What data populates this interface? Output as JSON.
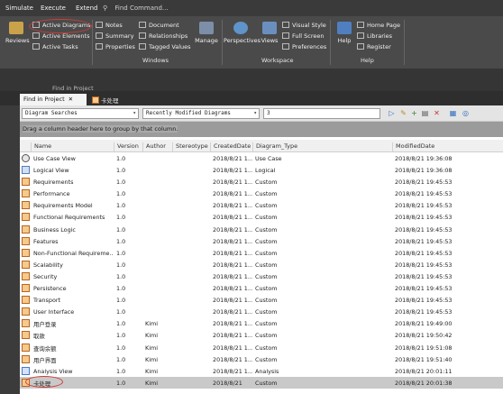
{
  "menu": {
    "items": [
      "Simulate",
      "Execute",
      "Extend"
    ],
    "find_command": "Find Command..."
  },
  "ribbon": {
    "reviews_label": "Reviews",
    "col1": [
      "Active Diagrams",
      "Active Elements",
      "Active Tasks"
    ],
    "col2": [
      "Notes",
      "Summary",
      "Properties"
    ],
    "col3": [
      "Document",
      "Relationships",
      "Tagged Values"
    ],
    "manage_label": "Manage",
    "windows_group": "Windows",
    "perspectives_label": "Perspectives",
    "views_label": "Views",
    "col4": [
      "Visual Style",
      "Full Screen",
      "Preferences"
    ],
    "workspace_group": "Workspace",
    "help_label": "Help",
    "col5": [
      "Home Page",
      "Libraries",
      "Register"
    ],
    "help_group": "Help"
  },
  "strip": {
    "in_project": "Find in Project"
  },
  "tabs": {
    "active": "Find in Project",
    "close": "✕",
    "other": "卡处理"
  },
  "toolbar": {
    "search_type": "Diagram Searches",
    "search_name": "Recently Modified Diagrams",
    "search_value": "3"
  },
  "groupby": {
    "hint": "Drag a column header here to group by that column."
  },
  "grid": {
    "columns": [
      "Name",
      "Version",
      "Author",
      "Stereotype",
      "CreatedDate",
      "Diagram_Type",
      "ModifiedDate"
    ],
    "rows": [
      {
        "icon": "usecase",
        "name": "Use Case View",
        "version": "1.0",
        "author": "",
        "stereo": "",
        "created": "2018/8/21 1...",
        "type": "Use Case",
        "modified": "2018/8/21 19:36:08"
      },
      {
        "icon": "logical",
        "name": "Logical View",
        "version": "1.0",
        "author": "",
        "stereo": "",
        "created": "2018/8/21 1...",
        "type": "Logical",
        "modified": "2018/8/21 19:36:08"
      },
      {
        "icon": "custom",
        "name": "Requirements",
        "version": "1.0",
        "author": "",
        "stereo": "",
        "created": "2018/8/21 1...",
        "type": "Custom",
        "modified": "2018/8/21 19:45:53"
      },
      {
        "icon": "custom",
        "name": "Performance",
        "version": "1.0",
        "author": "",
        "stereo": "",
        "created": "2018/8/21 1...",
        "type": "Custom",
        "modified": "2018/8/21 19:45:53"
      },
      {
        "icon": "custom",
        "name": "Requirements Model",
        "version": "1.0",
        "author": "",
        "stereo": "",
        "created": "2018/8/21 1...",
        "type": "Custom",
        "modified": "2018/8/21 19:45:53"
      },
      {
        "icon": "custom",
        "name": "Functional Requirements",
        "version": "1.0",
        "author": "",
        "stereo": "",
        "created": "2018/8/21 1...",
        "type": "Custom",
        "modified": "2018/8/21 19:45:53"
      },
      {
        "icon": "custom",
        "name": "Business Logic",
        "version": "1.0",
        "author": "",
        "stereo": "",
        "created": "2018/8/21 1...",
        "type": "Custom",
        "modified": "2018/8/21 19:45:53"
      },
      {
        "icon": "custom",
        "name": "Features",
        "version": "1.0",
        "author": "",
        "stereo": "",
        "created": "2018/8/21 1...",
        "type": "Custom",
        "modified": "2018/8/21 19:45:53"
      },
      {
        "icon": "custom",
        "name": "Non-Functional Requireme...",
        "version": "1.0",
        "author": "",
        "stereo": "",
        "created": "2018/8/21 1...",
        "type": "Custom",
        "modified": "2018/8/21 19:45:53"
      },
      {
        "icon": "custom",
        "name": "Scalability",
        "version": "1.0",
        "author": "",
        "stereo": "",
        "created": "2018/8/21 1...",
        "type": "Custom",
        "modified": "2018/8/21 19:45:53"
      },
      {
        "icon": "custom",
        "name": "Security",
        "version": "1.0",
        "author": "",
        "stereo": "",
        "created": "2018/8/21 1...",
        "type": "Custom",
        "modified": "2018/8/21 19:45:53"
      },
      {
        "icon": "custom",
        "name": "Persistence",
        "version": "1.0",
        "author": "",
        "stereo": "",
        "created": "2018/8/21 1...",
        "type": "Custom",
        "modified": "2018/8/21 19:45:53"
      },
      {
        "icon": "custom",
        "name": "Transport",
        "version": "1.0",
        "author": "",
        "stereo": "",
        "created": "2018/8/21 1...",
        "type": "Custom",
        "modified": "2018/8/21 19:45:53"
      },
      {
        "icon": "custom",
        "name": "User Interface",
        "version": "1.0",
        "author": "",
        "stereo": "",
        "created": "2018/8/21 1...",
        "type": "Custom",
        "modified": "2018/8/21 19:45:53"
      },
      {
        "icon": "custom",
        "name": "用户登录",
        "version": "1.0",
        "author": "Kimi",
        "stereo": "",
        "created": "2018/8/21 1...",
        "type": "Custom",
        "modified": "2018/8/21 19:49:00"
      },
      {
        "icon": "custom",
        "name": "取款",
        "version": "1.0",
        "author": "Kimi",
        "stereo": "",
        "created": "2018/8/21 1...",
        "type": "Custom",
        "modified": "2018/8/21 19:50:42"
      },
      {
        "icon": "custom",
        "name": "查询余额",
        "version": "1.0",
        "author": "Kimi",
        "stereo": "",
        "created": "2018/8/21 1...",
        "type": "Custom",
        "modified": "2018/8/21 19:51:08"
      },
      {
        "icon": "custom",
        "name": "用户界面",
        "version": "1.0",
        "author": "Kimi",
        "stereo": "",
        "created": "2018/8/21 1...",
        "type": "Custom",
        "modified": "2018/8/21 19:51:40"
      },
      {
        "icon": "analysis",
        "name": "Analysis View",
        "version": "1.0",
        "author": "Kimi",
        "stereo": "",
        "created": "2018/8/21 1...",
        "type": "Analysis",
        "modified": "2018/8/21 20:01:11"
      },
      {
        "icon": "custom",
        "name": "卡处理",
        "version": "1.0",
        "author": "Kimi",
        "stereo": "",
        "created": "2018/8/21",
        "type": "Custom",
        "modified": "2018/8/21 20:01:38",
        "selected": true
      }
    ]
  }
}
